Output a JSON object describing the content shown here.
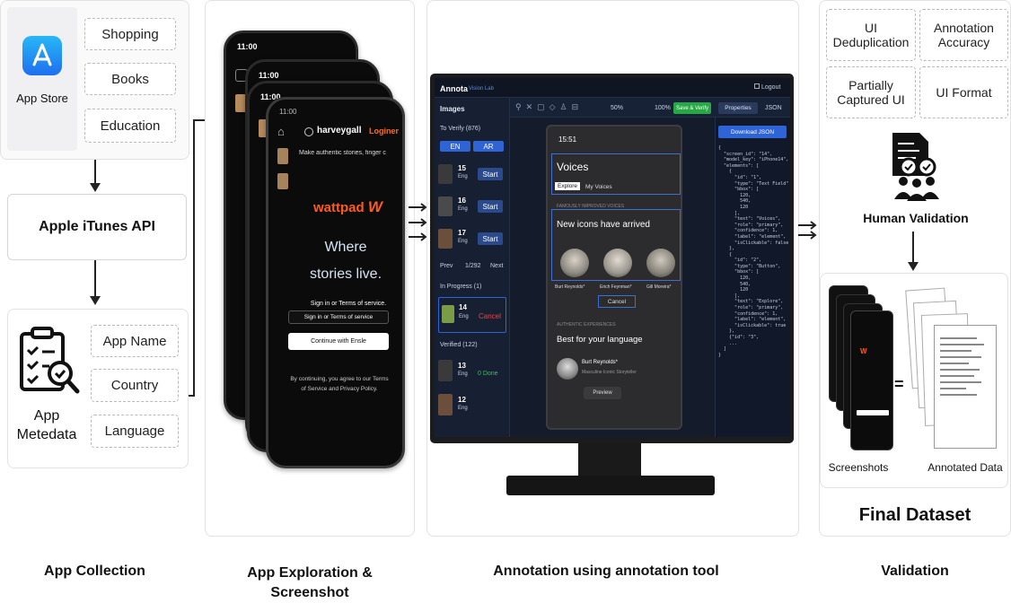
{
  "stage_captions": {
    "collection": "App Collection",
    "exploration": "App Exploration & Screenshot",
    "annotation": "Annotation using annotation tool",
    "validation": "Validation"
  },
  "collection": {
    "app_store_label": "App Store",
    "categories": [
      "Shopping",
      "Books",
      "Education"
    ],
    "api_label": "Apple iTunes API",
    "metadata_label": "App Metedata",
    "metadata_fields": [
      "App Name",
      "Country",
      "Language"
    ]
  },
  "phone": {
    "time": "11:00",
    "username": "harveygall",
    "login_link": "Loginer",
    "tagline": "Make authentic stories, finger c",
    "brand": "wattpad",
    "headline": "Where stories live.",
    "signin_text": "Sign in or Terms of service.",
    "signin_button": "Sign in or Terms of service",
    "continue_button": "Continue with Ensle",
    "footer": "By continuing, you agree to our Terms of Service and Privacy Policy."
  },
  "tool": {
    "app_name": "Annota",
    "app_sub": "Vision Lab",
    "logout": "Logout",
    "images_label": "Images",
    "to_verify": "To Verify (876)",
    "lang_en": "EN",
    "lang_ar": "AR",
    "verify_items": [
      {
        "num": "15",
        "lang": "Eng",
        "action": "Start"
      },
      {
        "num": "16",
        "lang": "Eng",
        "action": "Start"
      },
      {
        "num": "17",
        "lang": "Eng",
        "action": "Start"
      }
    ],
    "prev": "Prev",
    "page": "1/292",
    "next": "Next",
    "in_progress": "In Progress (1)",
    "progress_item": {
      "num": "14",
      "lang": "Eng",
      "action": "Cancel"
    },
    "verified": "Verified (122)",
    "verified_items": [
      {
        "num": "13",
        "lang": "Eng",
        "status": "Done"
      },
      {
        "num": "12",
        "lang": "Eng",
        "status": ""
      }
    ],
    "zoom": "50%",
    "zoom2": "100%",
    "save_verify": "Save & Verify",
    "properties": "Properties",
    "json_tab": "JSON",
    "download_json": "Download JSON",
    "screen": {
      "time": "15:51",
      "title": "Voices",
      "tab_explore": "Explore",
      "tab_my": "My Voices",
      "banner_small": "FAMOUSLY IMPROVED VOICES",
      "banner": "New icons have arrived",
      "people": [
        "Burt Reynolds*",
        "Erich Feynman*",
        "Gill Moreira*"
      ],
      "cancel": "Cancel",
      "section_small": "AUTHENTIC EXPERIENCES",
      "section": "Best for your language",
      "card_name": "Burt Reynolds*",
      "card_sub": "Masculine Iconic Storyteller",
      "preview": "Preview"
    },
    "json_lines": [
      "{",
      "  \"screen_id\": \"14\",",
      "  \"model_key\": \"iPhone14\",",
      "  \"elements\": [",
      "    {",
      "      \"id\": \"1\",",
      "      \"type\": \"Text Field\",",
      "      \"bbox\": [",
      "        120,",
      "        540,",
      "        120",
      "      ],",
      "      \"text\": \"Voices\",",
      "      \"role\": \"primary\",",
      "      \"confidence\": 1,",
      "      \"label\": \"element\",",
      "      \"isClickable\": false",
      "    },",
      "    {",
      "      \"id\": \"2\",",
      "      \"type\": \"Button\",",
      "      \"bbox\": [",
      "        120,",
      "        540,",
      "        120",
      "      ],",
      "      \"text\": \"Explore\",",
      "      \"role\": \"primary\",",
      "      \"confidence\": 1,",
      "      \"label\": \"element\",",
      "      \"isClickable\": true",
      "    },",
      "    {\"id\": \"3\",",
      "    ...",
      "  ]",
      "}"
    ]
  },
  "validation": {
    "checks": [
      "UI Deduplication",
      "Annotation Accuracy",
      "Partially Captured UI",
      "UI Format"
    ],
    "human_label": "Human Validation",
    "screenshots_label": "Screenshots",
    "annotated_label": "Annotated Data",
    "equals": "=",
    "final_label": "Final Dataset"
  }
}
